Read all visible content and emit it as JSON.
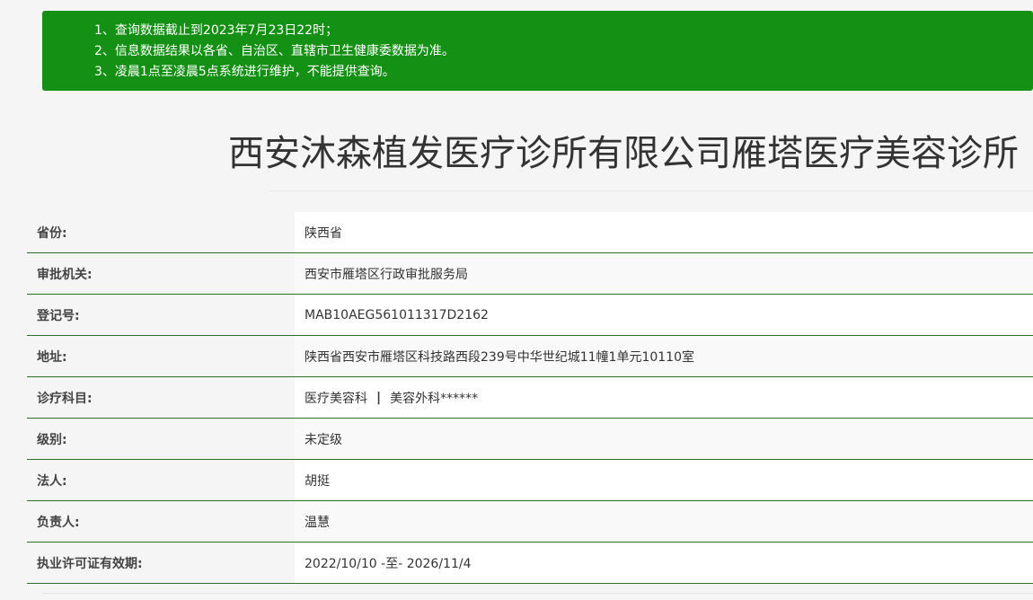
{
  "notice": {
    "lines": [
      "1、查询数据截止到2023年7月23日22时；",
      "2、信息数据结果以各省、自治区、直辖市卫生健康委数据为准。",
      "3、凌晨1点至凌晨5点系统进行维护，不能提供查询。"
    ]
  },
  "title": "西安沐森植发医疗诊所有限公司雁塔医疗美容诊所",
  "info": {
    "province": {
      "label": "省份:",
      "value": "陕西省"
    },
    "authority": {
      "label": "审批机关:",
      "value": "西安市雁塔区行政审批服务局"
    },
    "registration_no": {
      "label": "登记号:",
      "value": "MAB10AEG561011317D2162"
    },
    "address": {
      "label": "地址:",
      "value": "陕西省西安市雁塔区科技路西段239号中华世纪城11幢1单元10110室"
    },
    "departments": {
      "label": "诊疗科目:",
      "items": [
        "医疗美容科",
        "美容外科******"
      ],
      "separator": "|"
    },
    "level": {
      "label": "级别:",
      "value": "未定级"
    },
    "legal_person": {
      "label": "法人:",
      "value": "胡挺"
    },
    "responsible_person": {
      "label": "负责人:",
      "value": "温慧"
    },
    "license_validity": {
      "label": "执业许可证有效期:",
      "value": "2022/10/10 -至- 2026/11/4"
    }
  },
  "colors": {
    "notice_bg": "#149014",
    "row_divider": "#2f6e2f"
  }
}
